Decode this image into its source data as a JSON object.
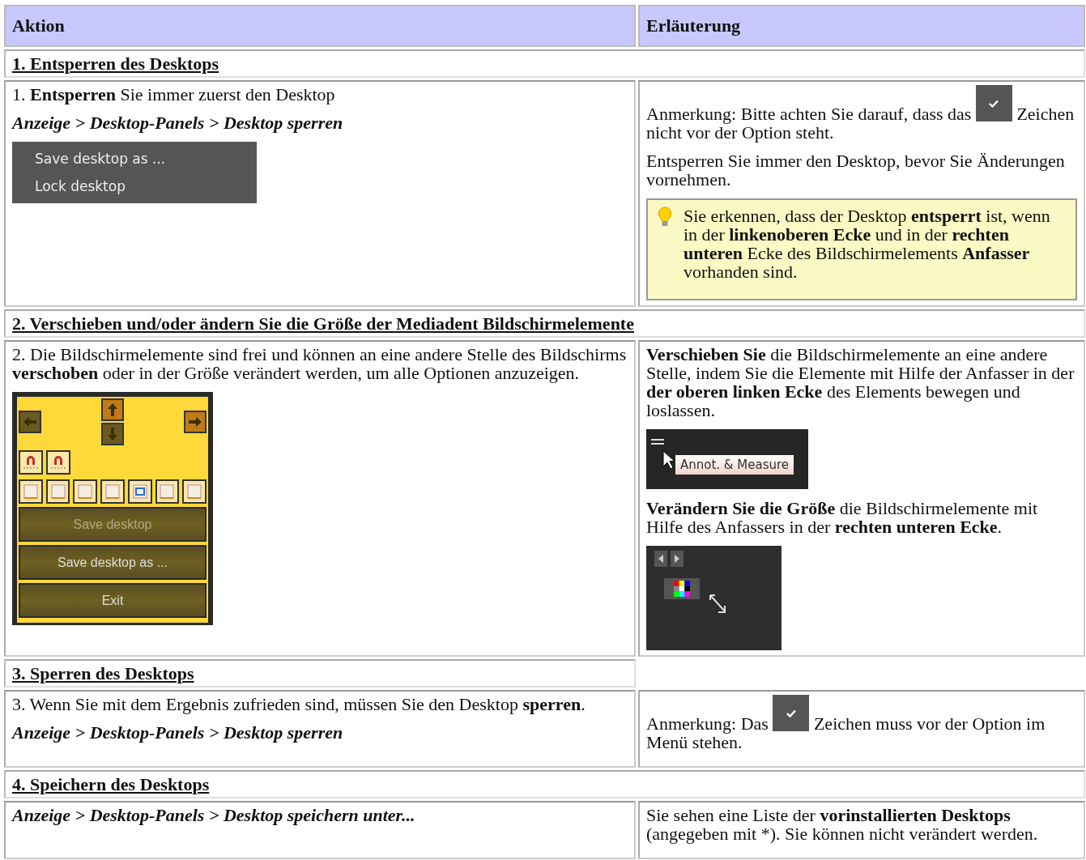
{
  "header": {
    "columns": [
      "Aktion",
      "Erläuterung"
    ]
  },
  "sections": [
    {
      "title": "1. Entsperren des Desktops",
      "heading_spans_both": true,
      "left": [
        {
          "kind": "text",
          "text": "1. **Entsperren** Sie immer zuerst den Desktop"
        },
        {
          "kind": "path",
          "text": "Anzeige > Desktop-Panels > Desktop sperren"
        },
        {
          "kind": "menu",
          "items": [
            "Save desktop as ...",
            "Lock desktop"
          ]
        }
      ],
      "right": [
        {
          "kind": "check_note",
          "before": "Anmerkung: Bitte achten Sie darauf, dass das",
          "after": "Zeichen nicht vor der Option steht."
        },
        {
          "kind": "text",
          "text": "Entsperren Sie immer den Desktop, bevor Sie Änderungen vornehmen."
        },
        {
          "kind": "tip",
          "text": "Sie erkennen, dass der Desktop **entsperrt** ist, wenn in der **linkenoberen Ecke** und in der **rechten unteren** Ecke des Bildschirmelements **Anfasser** vorhanden sind."
        }
      ]
    },
    {
      "title": "2. Verschieben und/oder ändern Sie die Größe der Mediadent Bildschirmelemente",
      "heading_spans_both": true,
      "left": [
        {
          "kind": "text",
          "text": "2. Die Bildschirmelemente sind frei und können an eine andere Stelle des Bildschirms **verschoben** oder in der Größe verändert werden, um alle Optionen anzuzeigen."
        },
        {
          "kind": "panel",
          "buttons": [
            {
              "label": "Save desktop",
              "disabled": true
            },
            {
              "label": "Save desktop as ...",
              "disabled": false
            },
            {
              "label": "Exit",
              "disabled": false
            }
          ]
        }
      ],
      "right": [
        {
          "kind": "text",
          "text": "**Verschieben Sie** die Bildschirmelemente an eine andere Stelle, indem Sie die Elemente mit Hilfe der Anfasser in der **der oberen linken Ecke** des Elements bewegen und loslassen."
        },
        {
          "kind": "handle_shot",
          "tab_label": "Annot. & Measure"
        },
        {
          "kind": "text",
          "text": "**Verändern Sie die Größe** die Bildschirmelemente mit Hilfe des Anfassers in der **rechten unteren Ecke**."
        },
        {
          "kind": "resize_shot"
        }
      ]
    },
    {
      "title": "3. Sperren des Desktops",
      "heading_spans_both": false,
      "left": [
        {
          "kind": "text",
          "text": "3. Wenn Sie mit dem Ergebnis zufrieden sind, müssen Sie den Desktop **sperren**."
        },
        {
          "kind": "path",
          "text": "Anzeige > Desktop-Panels > Desktop sperren"
        }
      ],
      "right": [
        {
          "kind": "check_note",
          "before": "Anmerkung: Das",
          "after": "Zeichen muss vor der Option im Menü stehen."
        }
      ]
    },
    {
      "title": "4. Speichern des Desktops",
      "heading_spans_both": true,
      "left": [
        {
          "kind": "path",
          "text": "Anzeige > Desktop-Panels > Desktop speichern unter..."
        }
      ],
      "right": [
        {
          "kind": "text",
          "text": "Sie sehen eine Liste der **vorinstallierten Desktops** (angegeben mit *). Sie können nicht verändert werden."
        }
      ]
    }
  ]
}
